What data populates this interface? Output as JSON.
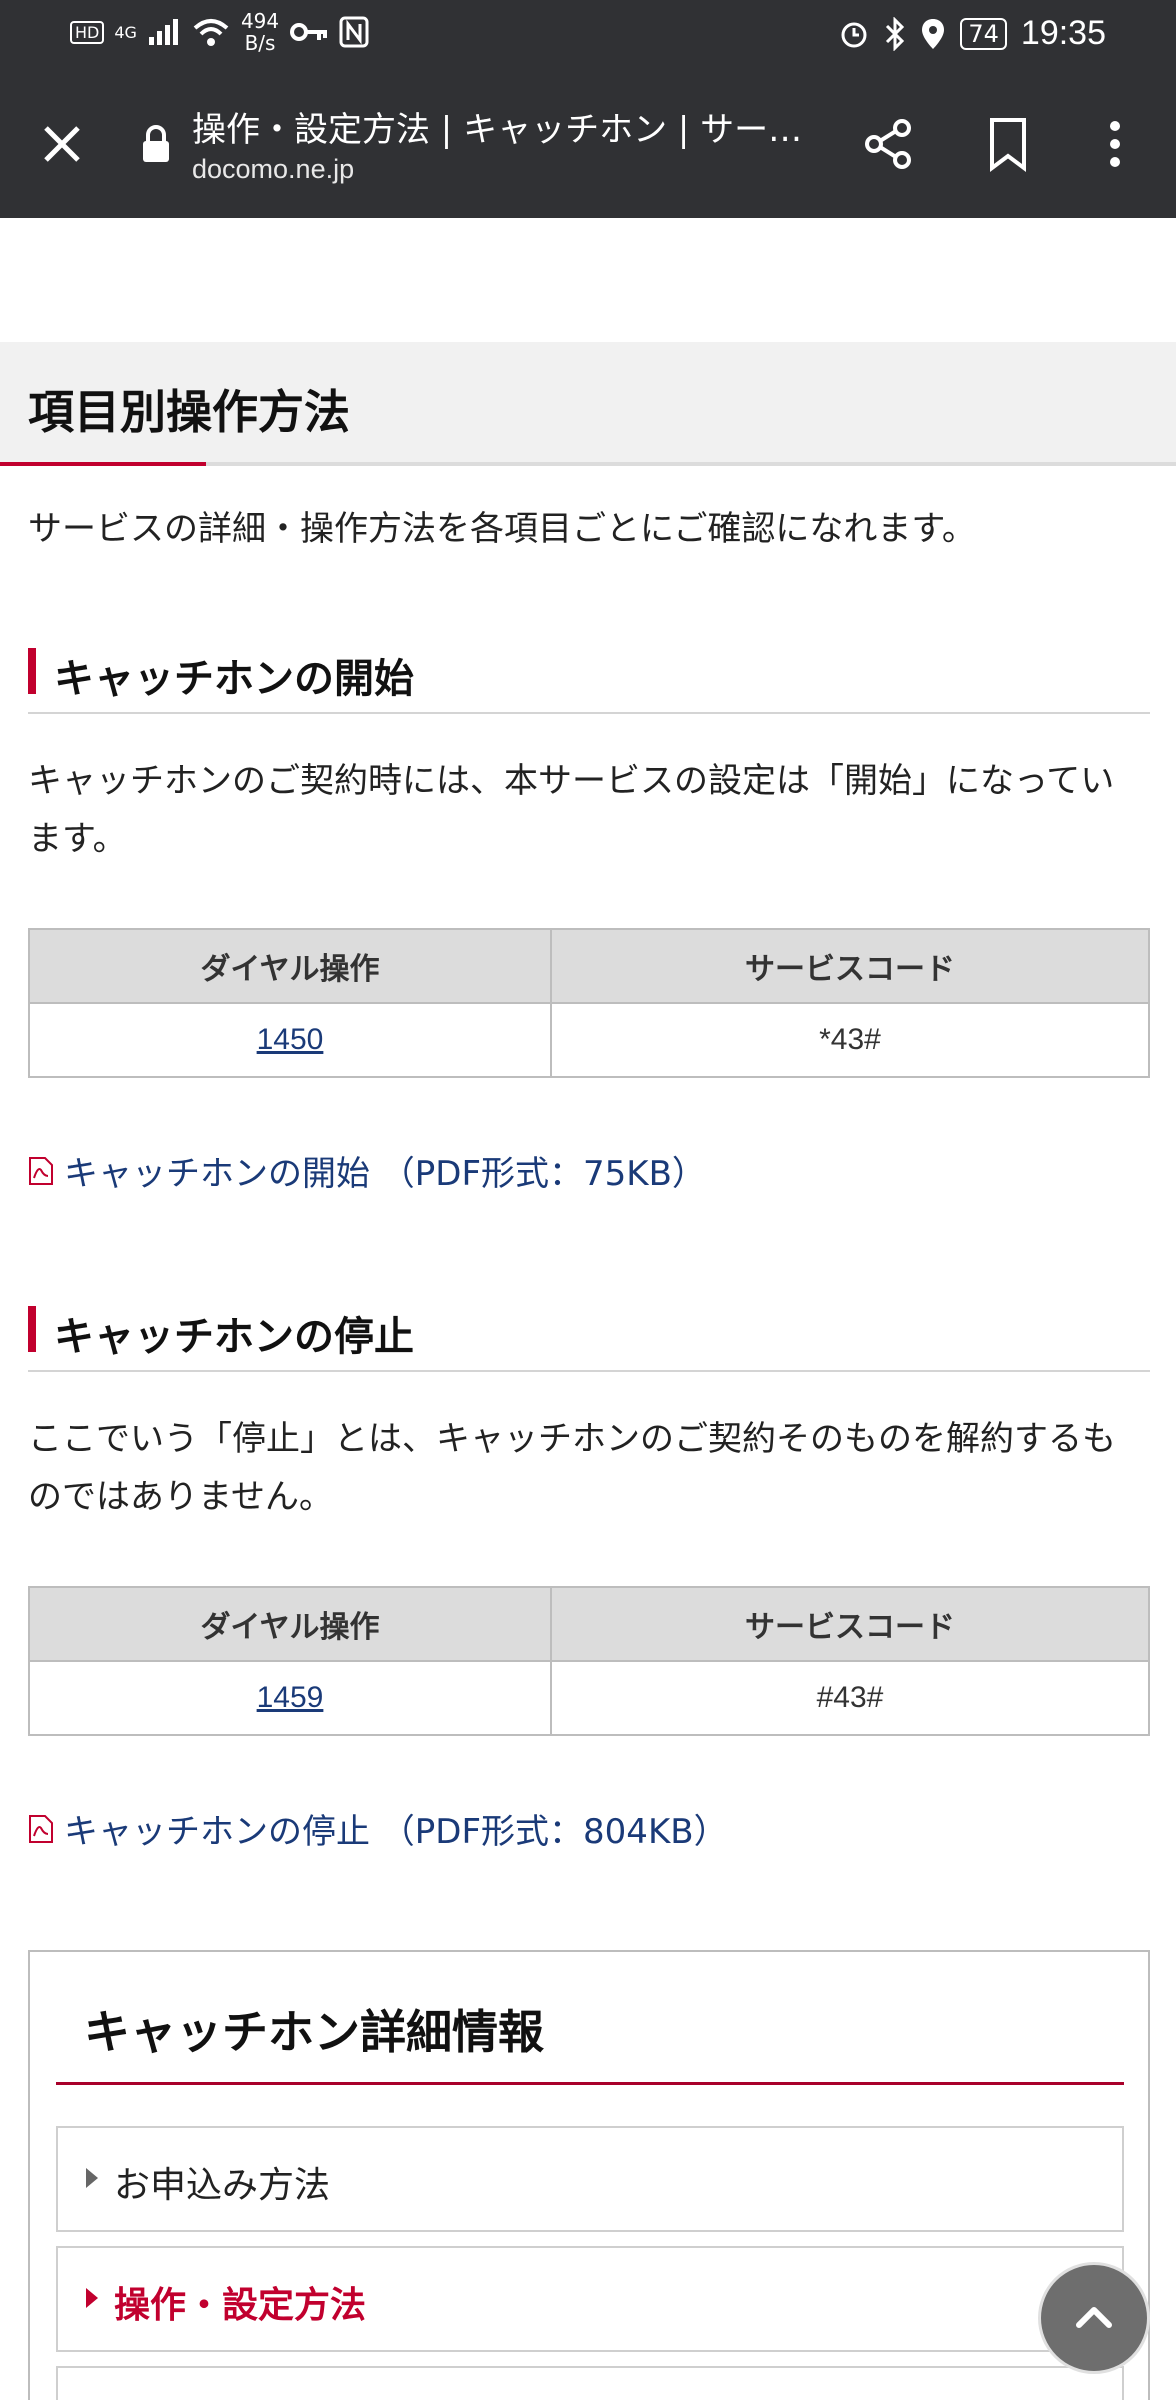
{
  "status_bar": {
    "network_speed": "494",
    "network_speed_unit": "B/s",
    "network_type": "4G",
    "battery": "74",
    "time": "19:35"
  },
  "browser": {
    "page_title": "操作・設定方法 | キャッチホン | サー…",
    "url": "docomo.ne.jp"
  },
  "page": {
    "section_title": "項目別操作方法",
    "intro": "サービスの詳細・操作方法を各項目ごとにご確認になれます。",
    "start": {
      "heading": "キャッチホンの開始",
      "description": "キャッチホンのご契約時には、本サービスの設定は「開始」になっています。",
      "table_headers": [
        "ダイヤル操作",
        "サービスコード"
      ],
      "dial": "1450",
      "service_code": "*43#",
      "pdf_link": "キャッチホンの開始 （PDF形式：75KB）"
    },
    "stop": {
      "heading": "キャッチホンの停止",
      "description": "ここでいう「停止」とは、キャッチホンのご契約そのものを解約するものではありません。",
      "table_headers": [
        "ダイヤル操作",
        "サービスコード"
      ],
      "dial": "1459",
      "service_code": "#43#",
      "pdf_link": "キャッチホンの停止 （PDF形式：804KB）"
    },
    "details": {
      "title": "キャッチホン詳細情報",
      "items": [
        {
          "label": "お申込み方法",
          "active": false
        },
        {
          "label": "操作・設定方法",
          "active": true
        }
      ]
    }
  },
  "colors": {
    "accent": "#c1002e",
    "link": "#1a3a78",
    "toolbar": "#303134"
  }
}
